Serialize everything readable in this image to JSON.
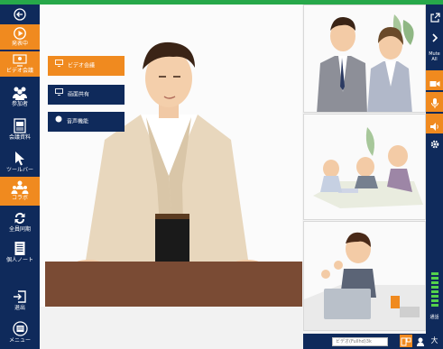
{
  "sidebar": {
    "items": [
      {
        "id": "back",
        "label": ""
      },
      {
        "id": "presenting",
        "label": "発表中"
      },
      {
        "id": "video_conf",
        "label": "ビデオ会議"
      },
      {
        "id": "participants",
        "label": "参加者"
      },
      {
        "id": "materials",
        "label": "会議資料"
      },
      {
        "id": "toolbar",
        "label": "ツールバー"
      },
      {
        "id": "collab",
        "label": "コラボ"
      },
      {
        "id": "sync_all",
        "label": "全員同期"
      },
      {
        "id": "personal_note",
        "label": "個人ノート"
      },
      {
        "id": "exit",
        "label": "退出"
      },
      {
        "id": "menu",
        "label": "メニュー"
      }
    ]
  },
  "submenu": {
    "video_conf": "ビデオ会議",
    "screen_share": "画面共有",
    "audio_only": "音声機能"
  },
  "right_bar": {
    "mute_all": "Mute All",
    "level_label": "通話"
  },
  "bottom": {
    "search_placeholder": "ビデオ(Fullhd)3k",
    "zoom_label": "大"
  },
  "colors": {
    "sidebar": "#0f2a5b",
    "accent": "#f08a1f",
    "top_bar": "#27a84a"
  }
}
